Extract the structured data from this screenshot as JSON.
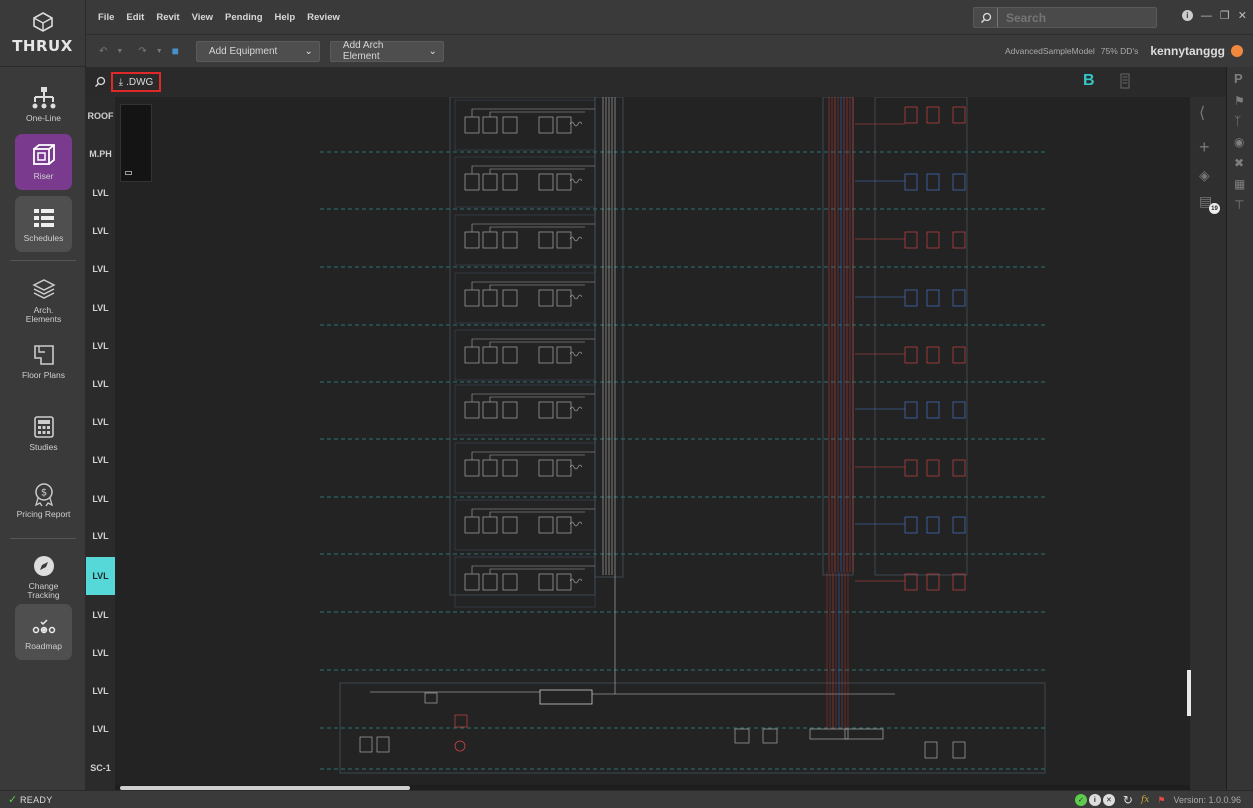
{
  "app": {
    "brand": "THRUX",
    "menu": [
      "File",
      "Edit",
      "Revit",
      "View",
      "Pending",
      "Help",
      "Review"
    ],
    "search_placeholder": "Search"
  },
  "toolbar": {
    "add_equipment": "Add Equipment",
    "add_arch_element": "Add Arch Element",
    "model_name": "AdvancedSampleModel",
    "phase": "75% DD's",
    "user": "kennytanggg"
  },
  "nav": {
    "one_line": "One-Line",
    "riser": "Riser",
    "schedules": "Schedules",
    "arch_elements": "Arch. Elements",
    "floor_plans": "Floor Plans",
    "studies": "Studies",
    "pricing_report": "Pricing Report",
    "change_tracking": "Change Tracking",
    "roadmap": "Roadmap"
  },
  "subbar": {
    "dwg_label": ".DWG",
    "b_label": "B"
  },
  "levels": [
    "ROOF",
    "M.PH",
    "LVL",
    "LVL",
    "LVL",
    "LVL",
    "LVL",
    "LVL",
    "LVL",
    "LVL",
    "LVL",
    "LVL",
    "LVL",
    "LVL",
    "LVL",
    "LVL",
    "LVL",
    "SC-1"
  ],
  "active_level_index": 12,
  "right_panel": {
    "badge": "19"
  },
  "status": {
    "ready": "READY",
    "version": "Version: 1.0.0.96"
  },
  "colors": {
    "accent_riser": "#7a3b8f",
    "active_level": "#56d8d8",
    "highlight_box": "#e0282a",
    "teal_b": "#35c6c6"
  }
}
